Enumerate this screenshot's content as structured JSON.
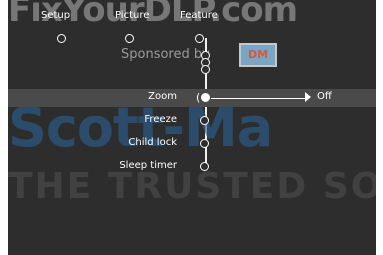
{
  "branding": {
    "site_watermark": "FixYourDLP.com",
    "middle_watermark": "Scott-Ma",
    "bottom_watermark": "THE TRUSTED SOU"
  },
  "tabs": [
    {
      "label": "Setup"
    },
    {
      "label": "Picture"
    },
    {
      "label": "Feature"
    }
  ],
  "sponsor": {
    "text": "Sponsored by",
    "logo_text": "DM"
  },
  "menu": {
    "items": [
      {
        "label": "Zoom",
        "value": "Off",
        "selected": true
      },
      {
        "label": "Freeze"
      },
      {
        "label": "Child lock"
      },
      {
        "label": "Sleep timer"
      }
    ]
  },
  "colors": {
    "screen_bg": "#2d2d2d",
    "selected_row_bg": "#4a4a4a",
    "menu_text": "#ffffff",
    "watermark_blue": "#2a5f8d"
  }
}
